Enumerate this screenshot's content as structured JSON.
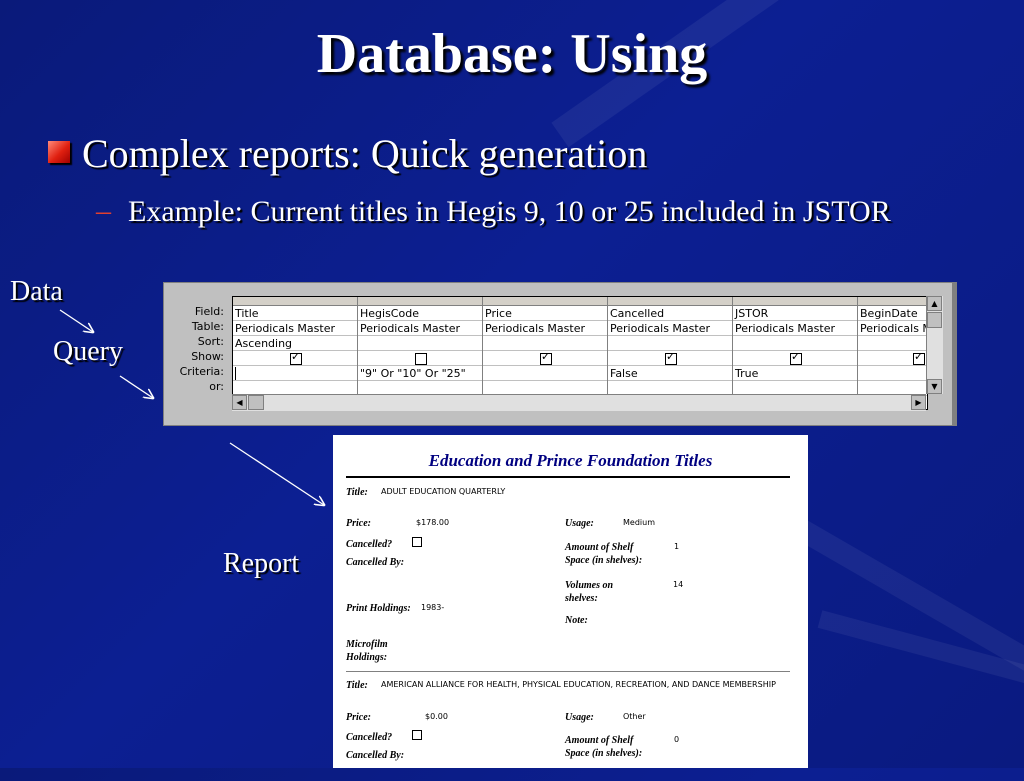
{
  "slide": {
    "title": "Database: Using",
    "bullet1": "Complex reports: Quick generation",
    "bullet2_dash": "–",
    "bullet2": "Example: Current titles in Hegis 9, 10 or 25 included in JSTOR",
    "labels": {
      "data": "Data",
      "query": "Query",
      "report": "Report"
    }
  },
  "query_grid": {
    "row_labels": [
      "Field:",
      "Table:",
      "Sort:",
      "Show:",
      "Criteria:",
      "or:"
    ],
    "columns": [
      {
        "field": "Title",
        "table": "Periodicals Master",
        "sort": "Ascending",
        "show": true,
        "criteria": "",
        "or": ""
      },
      {
        "field": "HegisCode",
        "table": "Periodicals Master",
        "sort": "",
        "show": false,
        "criteria": "\"9\" Or \"10\" Or \"25\"",
        "or": ""
      },
      {
        "field": "Price",
        "table": "Periodicals Master",
        "sort": "",
        "show": true,
        "criteria": "",
        "or": ""
      },
      {
        "field": "Cancelled",
        "table": "Periodicals Master",
        "sort": "",
        "show": true,
        "criteria": "False",
        "or": ""
      },
      {
        "field": "JSTOR",
        "table": "Periodicals Master",
        "sort": "",
        "show": true,
        "criteria": "True",
        "or": ""
      },
      {
        "field": "BeginDate",
        "table": "Periodicals M",
        "sort": "",
        "show": true,
        "criteria": "",
        "or": ""
      }
    ]
  },
  "report": {
    "title": "Education and Prince Foundation Titles",
    "labels": {
      "title": "Title:",
      "price": "Price:",
      "usage": "Usage:",
      "cancelled": "Cancelled?",
      "cancelled_by": "Cancelled By:",
      "shelf1": "Amount of Shelf",
      "shelf2": "Space (in shelves):",
      "volumes1": "Volumes on",
      "volumes2": "shelves:",
      "print_holdings": "Print Holdings:",
      "note": "Note:",
      "microfilm1": "Microfilm",
      "microfilm2": "Holdings:"
    },
    "records": [
      {
        "title": "ADULT EDUCATION QUARTERLY",
        "price": "$178.00",
        "usage": "Medium",
        "shelf": "1",
        "volumes": "14",
        "print_holdings": "1983-"
      },
      {
        "title": "AMERICAN ALLIANCE FOR HEALTH, PHYSICAL EDUCATION, RECREATION, AND DANCE MEMBERSHIP",
        "price": "$0.00",
        "usage": "Other",
        "shelf": "0"
      }
    ]
  }
}
